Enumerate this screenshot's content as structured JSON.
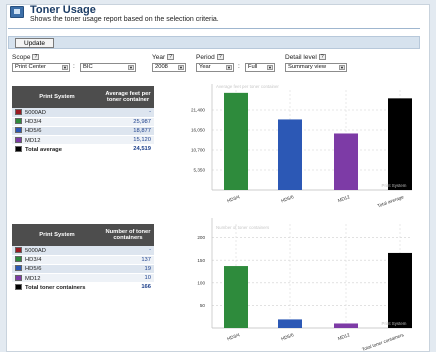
{
  "header": {
    "title": "Toner Usage",
    "subtitle": "Shows the toner usage report based on the selection criteria."
  },
  "toolbar": {
    "update_label": "Update"
  },
  "filters": {
    "scope_label": "Scope",
    "scope_value": "Print Center",
    "scope_sub_value": "BIC",
    "year_label": "Year",
    "year_value": "2008",
    "period_label": "Period",
    "period_value": "Year",
    "period_sub_value": "Full",
    "detail_label": "Detail level",
    "detail_value": "Summary view",
    "help_glyph": "?"
  },
  "table1": {
    "headers": [
      "Print System",
      "Average feet per toner container"
    ],
    "rows": [
      {
        "name": "5000AD",
        "value": "-",
        "color": "#9b1b22"
      },
      {
        "name": "HD3/4",
        "value": "25,987",
        "color": "#2e8b3c"
      },
      {
        "name": "HD5/6",
        "value": "18,877",
        "color": "#2c58b5"
      },
      {
        "name": "MD12",
        "value": "15,120",
        "color": "#7d3ba6"
      },
      {
        "name": "Total average",
        "value": "24,519",
        "color": "#000000"
      }
    ]
  },
  "table2": {
    "headers": [
      "Print System",
      "Number of toner containers"
    ],
    "rows": [
      {
        "name": "5000AD",
        "value": "-",
        "color": "#9b1b22"
      },
      {
        "name": "HD3/4",
        "value": "137",
        "color": "#2e8b3c"
      },
      {
        "name": "HD5/6",
        "value": "19",
        "color": "#2c58b5"
      },
      {
        "name": "MD12",
        "value": "10",
        "color": "#7d3ba6"
      },
      {
        "name": "Total toner containers",
        "value": "166",
        "color": "#000000"
      }
    ]
  },
  "chart_data": [
    {
      "type": "bar",
      "caption": "Average feet per toner container",
      "watermark": "Print System",
      "categories": [
        "HD3/4",
        "HD5/6",
        "MD12",
        "Total average"
      ],
      "values": [
        25987,
        18877,
        15120,
        24519
      ],
      "colors": [
        "#2e8b3c",
        "#2c58b5",
        "#7d3ba6",
        "#000000"
      ],
      "yticks": [
        "21,400",
        "16,050",
        "10,700",
        "5,350"
      ],
      "ytick_values": [
        21400,
        16050,
        10700,
        5350
      ],
      "ylim": [
        0,
        26750
      ],
      "grid": true
    },
    {
      "type": "bar",
      "caption": "Number of toner containers",
      "watermark": "Print System",
      "categories": [
        "HD3/4",
        "HD5/6",
        "MD12",
        "Total toner containers"
      ],
      "values": [
        137,
        19,
        10,
        166
      ],
      "colors": [
        "#2e8b3c",
        "#2c58b5",
        "#7d3ba6",
        "#000000"
      ],
      "yticks": [
        "200",
        "150",
        "100",
        "50"
      ],
      "ytick_values": [
        200,
        150,
        100,
        50
      ],
      "ylim": [
        0,
        230
      ],
      "grid": true
    }
  ]
}
